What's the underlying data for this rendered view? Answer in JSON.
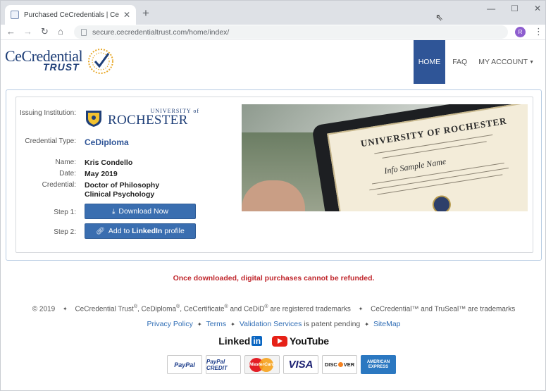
{
  "browser": {
    "tab_title": "Purchased CeCredentials | CeCre",
    "url": "secure.cecredentialtrust.com/home/index/",
    "profile_initial": "R"
  },
  "site": {
    "logo_line1": "CeCredential",
    "logo_line2": "TRUST",
    "nav": [
      "HOME",
      "FAQ",
      "MY ACCOUNT"
    ],
    "active_nav": "HOME"
  },
  "credential": {
    "labels": {
      "issuing": "Issuing Institution:",
      "type": "Credential Type:",
      "name": "Name:",
      "date": "Date:",
      "credential": "Credential:",
      "step1": "Step 1:",
      "step2": "Step 2:"
    },
    "institution_small": "UNIVERSITY of",
    "institution_big": "ROCHESTER",
    "type": "CeDiploma",
    "name": "Kris Condello",
    "date": "May 2019",
    "credential_line1": "Doctor of Philosophy",
    "credential_line2": "Clinical Psychology",
    "download_label": "Download Now",
    "linkedin_prefix": "Add to ",
    "linkedin_bold": "LinkedIn",
    "linkedin_suffix": " profile"
  },
  "diploma_image": {
    "title": "UNIVERSITY OF ROCHESTER",
    "name": "Info Sample Name"
  },
  "footer": {
    "warning": "Once downloaded, digital purchases cannot be refunded.",
    "legal_parts": {
      "year": "© 2019",
      "a": "CeCredential Trust",
      "b": ", CeDiploma",
      "c": ", CeCertificate",
      "d": " and CeDiD",
      "e": " are registered trademarks",
      "f": "CeCredential™ and TruSeal™ are trademarks",
      "reg": "®"
    },
    "links": {
      "privacy": "Privacy Policy",
      "terms": "Terms",
      "validation": "Validation Services",
      "patent": " is patent pending",
      "sitemap": "SiteMap"
    },
    "social": {
      "linkedin_text": "Linked",
      "linkedin_box": "in",
      "youtube": "YouTube"
    },
    "payments": {
      "paypal": "PayPal",
      "paypal_credit": "PayPal CREDIT",
      "mastercard": "MasterCard",
      "visa": "VISA",
      "discover_pre": "DISC",
      "discover_post": "VER",
      "amex": "AMERICAN EXPRESS"
    }
  },
  "colors": {
    "brand_blue": "#2f5597",
    "button_blue": "#3a6eb0",
    "warning_red": "#c0272d",
    "link_blue": "#2f6db5"
  }
}
